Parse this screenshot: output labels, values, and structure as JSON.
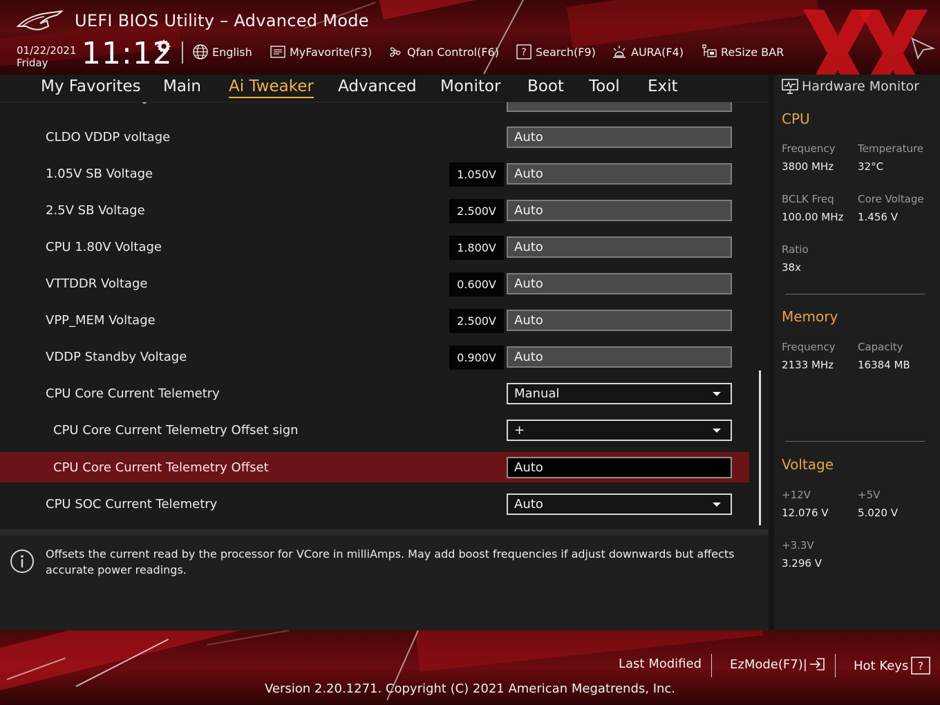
{
  "header": {
    "title": "UEFI BIOS Utility – Advanced Mode",
    "date": "01/22/2021",
    "day": "Friday",
    "time": "11:12"
  },
  "toolbar": [
    {
      "label": "English",
      "icon": "globe-icon"
    },
    {
      "label": "MyFavorite(F3)",
      "icon": "favorite-list-icon"
    },
    {
      "label": "Qfan Control(F6)",
      "icon": "fan-icon"
    },
    {
      "label": "Search(F9)",
      "icon": "search-help-icon"
    },
    {
      "label": "AURA(F4)",
      "icon": "aura-light-icon"
    },
    {
      "label": "ReSize BAR",
      "icon": "resize-bar-icon"
    }
  ],
  "nav": {
    "tabs": [
      "My Favorites",
      "Main",
      "Ai Tweaker",
      "Advanced",
      "Monitor",
      "Boot",
      "Tool",
      "Exit"
    ],
    "active": "Ai Tweaker"
  },
  "settings": [
    {
      "label": "CLDO VDDP voltage",
      "chip": "",
      "value": "Auto",
      "kind": "field"
    },
    {
      "label": "1.05V SB Voltage",
      "chip": "1.050V",
      "value": "Auto",
      "kind": "field"
    },
    {
      "label": "2.5V SB Voltage",
      "chip": "2.500V",
      "value": "Auto",
      "kind": "field"
    },
    {
      "label": "CPU 1.80V Voltage",
      "chip": "1.800V",
      "value": "Auto",
      "kind": "field"
    },
    {
      "label": "VTTDDR Voltage",
      "chip": "0.600V",
      "value": "Auto",
      "kind": "field"
    },
    {
      "label": "VPP_MEM Voltage",
      "chip": "2.500V",
      "value": "Auto",
      "kind": "field"
    },
    {
      "label": "VDDP Standby Voltage",
      "chip": "0.900V",
      "value": "Auto",
      "kind": "field"
    },
    {
      "label": "CPU Core Current Telemetry",
      "chip": "",
      "value": "Manual",
      "kind": "dropdown"
    },
    {
      "label": "CPU Core Current Telemetry Offset sign",
      "chip": "",
      "value": "+",
      "kind": "dropdown"
    },
    {
      "label": "CPU Core Current Telemetry Offset",
      "chip": "",
      "value": "Auto",
      "kind": "edit"
    },
    {
      "label": "CPU SOC Current Telemetry",
      "chip": "",
      "value": "Auto",
      "kind": "dropdown"
    }
  ],
  "selected_setting": "CPU Core Current Telemetry Offset",
  "help_text": "Offsets the current read by the processor for VCore in milliAmps. May add boost frequencies if adjust downwards but affects accurate power readings.",
  "hw_monitor": {
    "title": "Hardware Monitor",
    "cpu": {
      "heading": "CPU",
      "frequency_label": "Frequency",
      "frequency": "3800 MHz",
      "temperature_label": "Temperature",
      "temperature": "32°C",
      "bclk_label": "BCLK Freq",
      "bclk": "100.00 MHz",
      "core_voltage_label": "Core Voltage",
      "core_voltage": "1.456 V",
      "ratio_label": "Ratio",
      "ratio": "38x"
    },
    "memory": {
      "heading": "Memory",
      "frequency_label": "Frequency",
      "frequency": "2133 MHz",
      "capacity_label": "Capacity",
      "capacity": "16384 MB"
    },
    "voltage": {
      "heading": "Voltage",
      "v12_label": "+12V",
      "v12": "12.076 V",
      "v5_label": "+5V",
      "v5": "5.020 V",
      "v33_label": "+3.3V",
      "v33": "3.296 V"
    }
  },
  "footer": {
    "last_modified": "Last Modified",
    "ezmode": "EzMode(F7)|",
    "hotkeys": "Hot Keys",
    "version": "Version 2.20.1271. Copyright (C) 2021 American Megatrends, Inc."
  },
  "colors": {
    "accent": "#f0b24c",
    "section_heading": "#e8a54a",
    "selected_row": "#6b1417",
    "theme_red": "#b01018"
  }
}
